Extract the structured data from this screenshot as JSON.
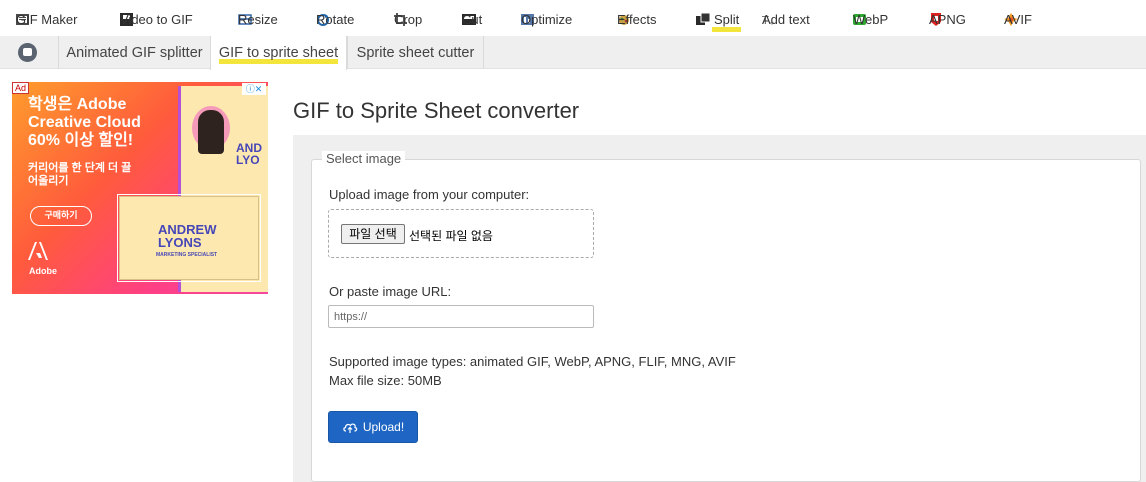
{
  "topnav": {
    "items": [
      {
        "label": "GIF Maker",
        "icon": "gif-maker-icon"
      },
      {
        "label": "Video to GIF",
        "icon": "video-icon"
      },
      {
        "label": "Resize",
        "icon": "resize-icon"
      },
      {
        "label": "Rotate",
        "icon": "rotate-icon"
      },
      {
        "label": "Crop",
        "icon": "crop-icon"
      },
      {
        "label": "Cut",
        "icon": "cut-icon"
      },
      {
        "label": "Optimize",
        "icon": "optimize-icon"
      },
      {
        "label": "Effects",
        "icon": "effects-icon"
      },
      {
        "label": "Split",
        "icon": "split-icon",
        "active": true
      },
      {
        "label": "Add text",
        "icon": "add-text-icon"
      },
      {
        "label": "WebP",
        "icon": "webp-icon"
      },
      {
        "label": "APNG",
        "icon": "apng-icon"
      },
      {
        "label": "AVIF",
        "icon": "avif-icon"
      }
    ],
    "highlight_color": "#f3e53b"
  },
  "subnav": {
    "home_icon": "home-icon",
    "tabs": [
      {
        "label": "Animated GIF splitter"
      },
      {
        "label": "GIF to sprite sheet",
        "active": true
      },
      {
        "label": "Sprite sheet cutter"
      }
    ]
  },
  "ad": {
    "tag": "Ad",
    "controls": "ⓘ✕",
    "headline": "학생은 Adobe Creative Cloud 60% 이상 할인!",
    "subline": "커리어를 한 단계 더 끌어올리기",
    "cta": "구매하기",
    "brand": "Adobe",
    "card_name_front": "ANDREW LYONS",
    "card_sub_front": "MARKETING SPECIALIST",
    "card_name_back": "AND LYO"
  },
  "main": {
    "title": "GIF to Sprite Sheet converter",
    "legend": "Select image",
    "upload_label": "Upload image from your computer:",
    "file_button": "파일 선택",
    "file_status": "선택된 파일 없음",
    "url_label": "Or paste image URL:",
    "url_placeholder": "https://",
    "supported": "Supported image types: animated GIF, WebP, APNG, FLIF, MNG, AVIF",
    "max_size": "Max file size: 50MB",
    "upload_button": "Upload!",
    "accent_color": "#1f66c4"
  }
}
